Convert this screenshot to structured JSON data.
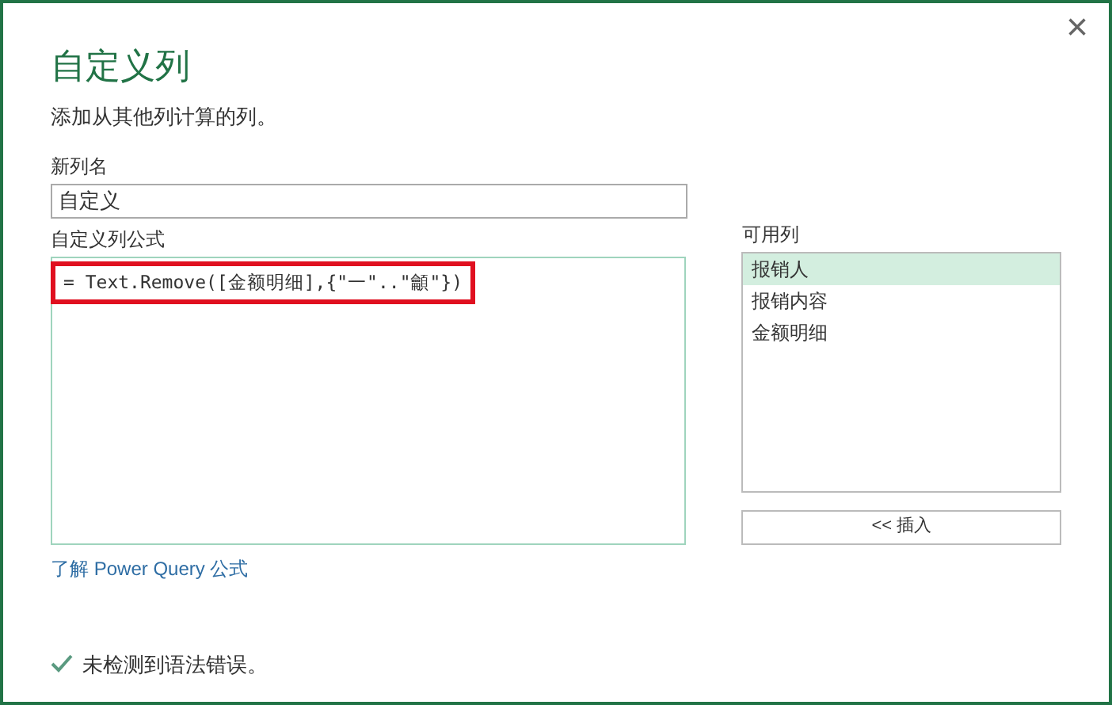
{
  "dialog": {
    "title": "自定义列",
    "subtitle": "添加从其他列计算的列。",
    "close_glyph": "×"
  },
  "name_field": {
    "label": "新列名",
    "value": "自定义"
  },
  "formula": {
    "label": "自定义列公式",
    "value": "= Text.Remove([金额明细],{\"一\"..\"龥\"})",
    "highlighted": true
  },
  "available_columns": {
    "label": "可用列",
    "items": [
      {
        "label": "报销人",
        "selected": true
      },
      {
        "label": "报销内容",
        "selected": false
      },
      {
        "label": "金额明细",
        "selected": false
      }
    ]
  },
  "insert_button": "<< 插入",
  "link": {
    "prefix": "了解",
    "text": "Power Query 公式"
  },
  "status": {
    "text": "未检测到语法错误。",
    "ok": true
  }
}
